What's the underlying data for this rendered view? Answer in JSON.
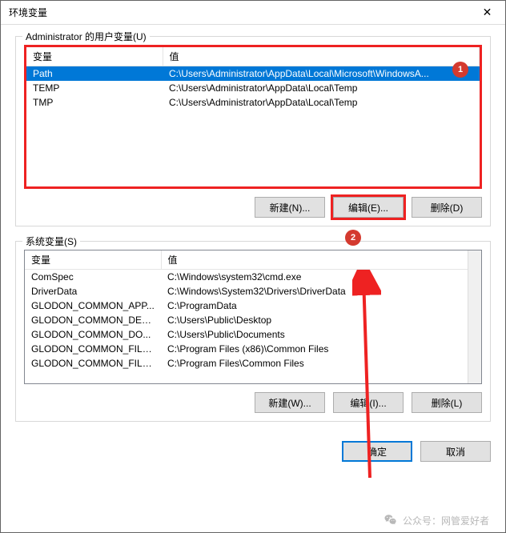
{
  "window": {
    "title": "环境变量"
  },
  "user_section": {
    "label": "Administrator 的用户变量(U)",
    "headers": {
      "var": "变量",
      "val": "值"
    },
    "rows": [
      {
        "var": "Path",
        "val": "C:\\Users\\Administrator\\AppData\\Local\\Microsoft\\WindowsA..."
      },
      {
        "var": "TEMP",
        "val": "C:\\Users\\Administrator\\AppData\\Local\\Temp"
      },
      {
        "var": "TMP",
        "val": "C:\\Users\\Administrator\\AppData\\Local\\Temp"
      }
    ],
    "buttons": {
      "new": "新建(N)...",
      "edit": "编辑(E)...",
      "del": "删除(D)"
    }
  },
  "sys_section": {
    "label": "系统变量(S)",
    "headers": {
      "var": "变量",
      "val": "值"
    },
    "rows": [
      {
        "var": "ComSpec",
        "val": "C:\\Windows\\system32\\cmd.exe"
      },
      {
        "var": "DriverData",
        "val": "C:\\Windows\\System32\\Drivers\\DriverData"
      },
      {
        "var": "GLODON_COMMON_APP...",
        "val": "C:\\ProgramData"
      },
      {
        "var": "GLODON_COMMON_DES...",
        "val": "C:\\Users\\Public\\Desktop"
      },
      {
        "var": "GLODON_COMMON_DO...",
        "val": "C:\\Users\\Public\\Documents"
      },
      {
        "var": "GLODON_COMMON_FILE...",
        "val": "C:\\Program Files (x86)\\Common Files"
      },
      {
        "var": "GLODON_COMMON_FILE...",
        "val": "C:\\Program Files\\Common Files"
      }
    ],
    "buttons": {
      "new": "新建(W)...",
      "edit": "编辑(I)...",
      "del": "删除(L)"
    }
  },
  "footer": {
    "ok": "确定",
    "cancel": "取消"
  },
  "badges": {
    "one": "1",
    "two": "2"
  },
  "watermark": "公众号：网管爱好者"
}
